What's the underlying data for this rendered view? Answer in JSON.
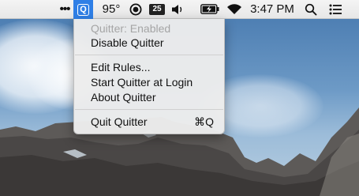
{
  "menubar": {
    "overflow_dots": "•••",
    "quitter_icon_letter": "Q",
    "temperature": "95°",
    "calendar_day": "25",
    "clock": "3:47 PM",
    "icons": [
      "overflow-dots-icon",
      "quitter-icon",
      "record-icon",
      "calendar-icon",
      "volume-icon",
      "battery-charging-icon",
      "wifi-icon",
      "spotlight-search-icon",
      "notification-list-icon"
    ],
    "accent_color": "#2f7fe6"
  },
  "quitter_menu": {
    "status": "Quitter: Enabled",
    "disable": "Disable Quitter",
    "edit_rules": "Edit Rules...",
    "start_at_login": "Start Quitter at Login",
    "about": "About Quitter",
    "quit": "Quit Quitter",
    "quit_shortcut": "⌘Q"
  }
}
